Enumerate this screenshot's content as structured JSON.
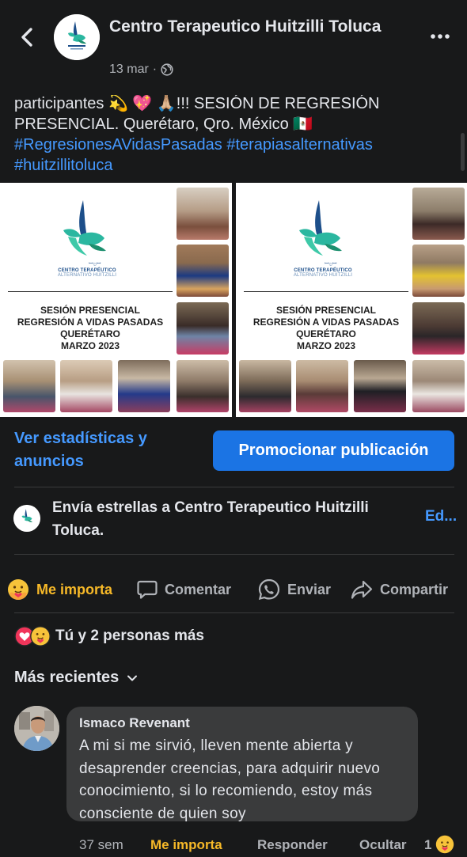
{
  "header": {
    "page_name": "Centro Terapeutico Huitzilli Toluca",
    "date": "13 mar",
    "separator": "·",
    "icons": {
      "back": "chevron-left-icon",
      "privacy": "globe-icon",
      "more": "more-horizontal-icon"
    }
  },
  "post": {
    "text_line1": "participantes 💫 💖 🙏🏼!!! SESIÓN DE REGRESIÓN",
    "text_line2": "PRESENCIAL. Querétaro, Qro. México 🇲🇽",
    "hashtag1": "#RegresionesAVidasPasadas",
    "hashtag2": "#terapiasalternativas",
    "hashtag3": "#huitzillitoluca"
  },
  "images": {
    "logo_caption": "CENTRO TERAPÉUTICO",
    "logo_subcaption": "ALTERNATIVO HUITZILLI",
    "flyer_line1": "SESIÓN PRESENCIAL",
    "flyer_line2": "REGRESIÓN A VIDAS PASADAS",
    "flyer_line3": "QUERÉTARO",
    "flyer_line4": "MARZO 2023"
  },
  "actions": {
    "stats_link": "Ver estadísticas y anuncios",
    "promote_button": "Promocionar publicación"
  },
  "stars": {
    "text": "Envía estrellas a Centro Terapeutico Huitzilli Toluca.",
    "edit_link": "Ed..."
  },
  "reaction_bar": {
    "care": "Me importa",
    "comment": "Comentar",
    "send": "Enviar",
    "share": "Compartir"
  },
  "summary": {
    "text": "Tú y 2 personas más"
  },
  "sort": {
    "label": "Más recientes"
  },
  "comment": {
    "author": "Ismaco Revenant",
    "text": "A mi si me sirvió, lleven mente abierta y desaprender  creencias, para adquirir nuevo conocimiento, si lo recomiendo, estoy más consciente de quien soy",
    "time": "37 sem",
    "like": "Me importa",
    "reply": "Responder",
    "hide": "Ocultar",
    "reaction_count": "1"
  },
  "colors": {
    "background": "#18191a",
    "link": "#4599ff",
    "button": "#1b74e4",
    "care": "#f7b928",
    "bubble": "#3a3b3c"
  }
}
